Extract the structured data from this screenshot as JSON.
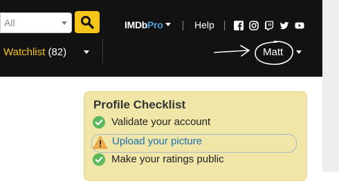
{
  "search": {
    "category": "All"
  },
  "header": {
    "imdbpro_brand": "IMDb",
    "imdbpro_suffix": "Pro",
    "help_label": "Help",
    "social_icons": [
      "facebook-icon",
      "instagram-icon",
      "twitch-icon",
      "twitter-icon",
      "youtube-icon"
    ]
  },
  "watchlist": {
    "label": "Watchlist",
    "count": "(82)"
  },
  "user": {
    "name": "Matt"
  },
  "checklist": {
    "title": "Profile Checklist",
    "items": [
      {
        "label": "Validate your account",
        "status": "done"
      },
      {
        "label": "Upload your picture",
        "status": "warning"
      },
      {
        "label": "Make your ratings public",
        "status": "done"
      }
    ]
  },
  "colors": {
    "navbar": "#121212",
    "accent_yellow": "#f5c518",
    "pro_blue": "#4ea0e0",
    "checklist_bg": "#f0e6a8",
    "check_green": "#5cb85c",
    "warning_yellow": "#f0ad4e",
    "link_blue": "#1a6fb0"
  }
}
